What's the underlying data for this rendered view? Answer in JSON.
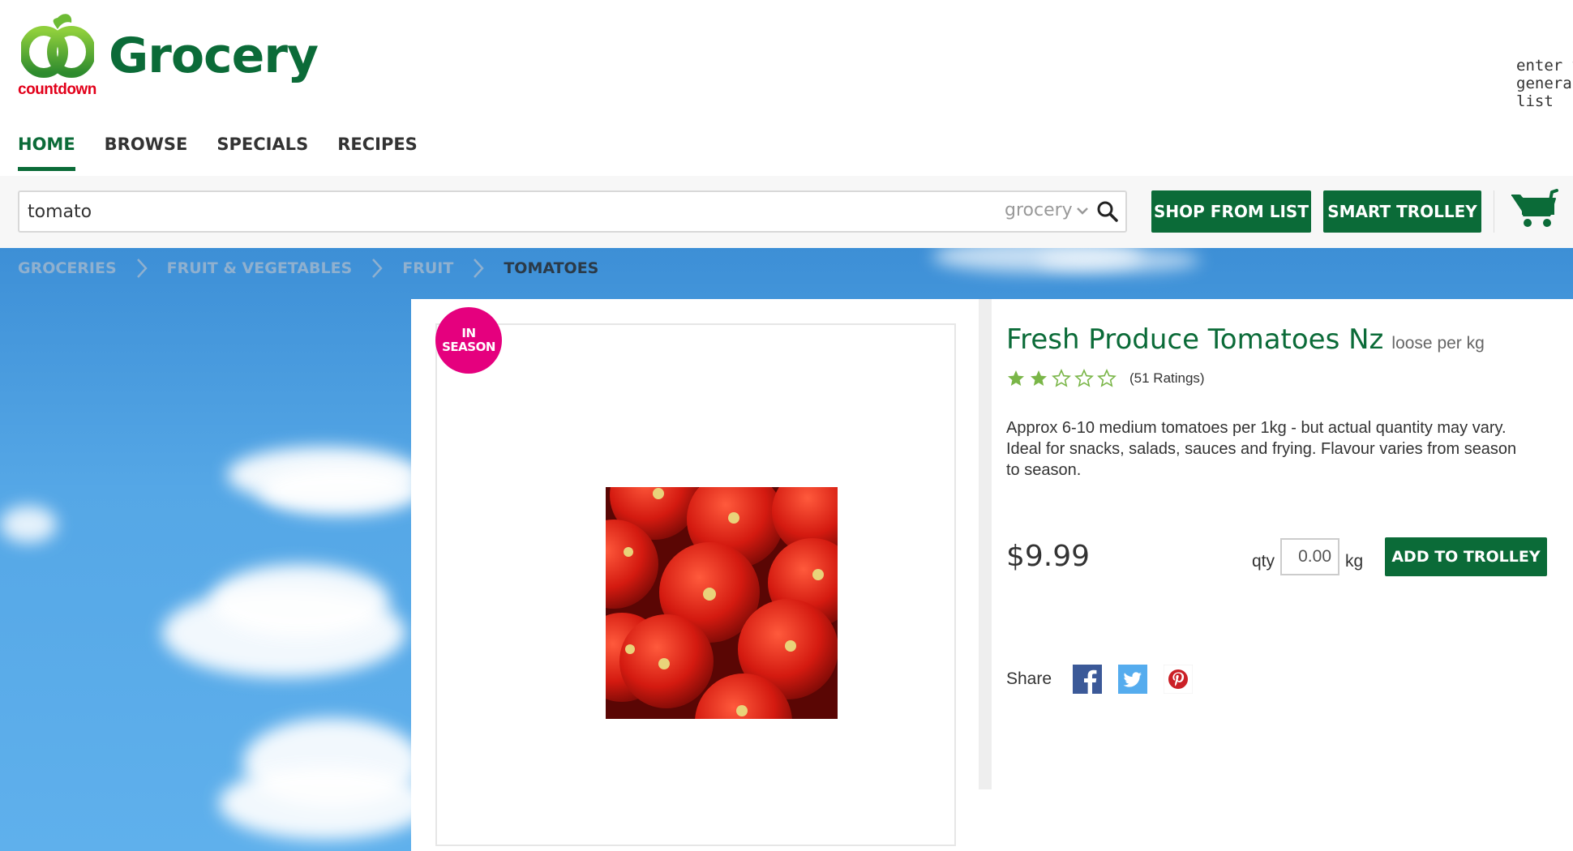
{
  "header": {
    "brand": "countdown",
    "title": "Grocery",
    "list_hint": [
      "enter y",
      "genera",
      "list"
    ]
  },
  "nav": {
    "items": [
      "HOME",
      "BROWSE",
      "SPECIALS",
      "RECIPES"
    ],
    "active": "HOME"
  },
  "search": {
    "value": "tomato",
    "scope": "grocery"
  },
  "toolbar": {
    "shop_from_list": "SHOP FROM LIST",
    "smart_trolley": "SMART TROLLEY"
  },
  "breadcrumb": [
    "GROCERIES",
    "FRUIT & VEGETABLES",
    "FRUIT",
    "TOMATOES"
  ],
  "product": {
    "badge_line1": "IN",
    "badge_line2": "SEASON",
    "title": "Fresh Produce Tomatoes Nz",
    "unit": "loose per kg",
    "rating": 2,
    "rating_max": 5,
    "rating_count": "(51 Ratings)",
    "description": "Approx 6-10 medium tomatoes per 1kg - but actual quantity may vary. Ideal for snacks, salads, sauces and frying. Flavour varies from season to season.",
    "price": "$9.99",
    "qty_label": "qty",
    "qty_value": "0.00",
    "qty_unit": "kg",
    "add_button": "ADD TO TROLLEY",
    "share_label": "Share",
    "share_icons": [
      "facebook-icon",
      "twitter-icon",
      "pinterest-icon"
    ]
  },
  "colors": {
    "brand_green": "#0b6b38",
    "brand_red": "#e2001a",
    "badge_pink": "#e5007e",
    "sky_blue": "#55a7e6",
    "star_green": "#7ab648"
  }
}
